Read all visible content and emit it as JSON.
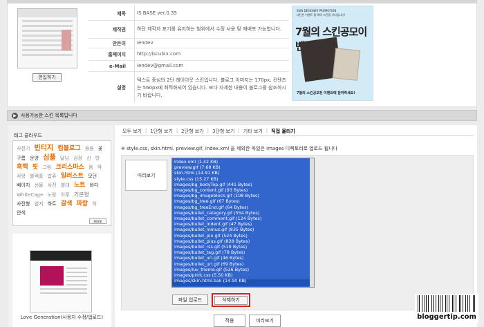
{
  "info": {
    "rows": [
      {
        "label": "제목",
        "value": "IS BASE ver.0.35"
      },
      {
        "label": "제작권",
        "value": "하단 제작자 표기를 유지하는 범위에서 수정 사용 및 재배포 가능합니다."
      },
      {
        "label": "만든이",
        "value": "iendev"
      },
      {
        "label": "홈페이지",
        "value": "http://iscubix.com"
      },
      {
        "label": "e-Mail",
        "value": "iendev@gmail.com"
      },
      {
        "label": "설명",
        "value": "텍스트 중심의 2단 레이아웃 스킨입니다. 블로그 이미지는 170px, 컨텐츠는 560px에 최적화되어 있습니다. 보다 자세한 내용이 블로그를 참조하시기 바랍니다."
      }
    ],
    "edit_button": "편집하기"
  },
  "banner": {
    "small_text": "SKIN DESIGNER PROMOTION",
    "small_text2": "대단한 이벤트 올 해의 스킨을 기다립니다!",
    "title": "7월의 스킨공모이벤트",
    "bottom_text": "7월의 스킨공모전 이벤트에 참여하세요!"
  },
  "section": {
    "title": "사용가능한 스킨 목록입니다"
  },
  "tag_cloud": {
    "title": "태그 클라우드",
    "tags": [
      {
        "text": "사진기",
        "style": "s"
      },
      {
        "text": "빈티지",
        "style": "ob"
      },
      {
        "text": "컴블로그",
        "style": "o"
      },
      {
        "text": "용용",
        "style": "s"
      },
      {
        "text": "꽃",
        "style": "d"
      },
      {
        "text": "구름",
        "style": "d"
      },
      {
        "text": "운양",
        "style": "d"
      },
      {
        "text": "심플",
        "style": "ob"
      },
      {
        "text": "달님",
        "style": "s"
      },
      {
        "text": "검정",
        "style": "s"
      },
      {
        "text": "신",
        "style": "s"
      },
      {
        "text": "방",
        "style": "s"
      },
      {
        "text": "흑백",
        "style": "o"
      },
      {
        "text": "핏",
        "style": "o"
      },
      {
        "text": "그림",
        "style": "s"
      },
      {
        "text": "크리스마스",
        "style": "o"
      },
      {
        "text": "음",
        "style": "s"
      },
      {
        "text": "악",
        "style": "s"
      },
      {
        "text": "사랑",
        "style": "s"
      },
      {
        "text": "블랙홀",
        "style": "s"
      },
      {
        "text": "밥쥬",
        "style": "s"
      },
      {
        "text": "일러스트",
        "style": "o"
      },
      {
        "text": "모던",
        "style": "d"
      },
      {
        "text": "베이지",
        "style": "d"
      },
      {
        "text": "선물",
        "style": "s"
      },
      {
        "text": "사진",
        "style": "s"
      },
      {
        "text": "블대",
        "style": "s"
      },
      {
        "text": "노트",
        "style": "o"
      },
      {
        "text": "바다",
        "style": "d"
      },
      {
        "text": "WhiteCage",
        "style": "s"
      },
      {
        "text": "노랑",
        "style": "s"
      },
      {
        "text": "이루",
        "style": "s"
      },
      {
        "text": "기본형",
        "style": "m"
      },
      {
        "text": "사진형",
        "style": "d"
      },
      {
        "text": "염지",
        "style": "s"
      },
      {
        "text": "하트",
        "style": "d"
      },
      {
        "text": "갈색",
        "style": "o"
      },
      {
        "text": "파랑",
        "style": "o"
      },
      {
        "text": "하",
        "style": "s"
      },
      {
        "text": "얀색",
        "style": "d"
      }
    ],
    "more": "MORE"
  },
  "skin_item": {
    "name": "Love Generation(사용자 수정/업로드)"
  },
  "tabs": {
    "items": [
      "모두 보기",
      "1단형 보기",
      "2단형 보기",
      "3단형 보기",
      "기타 보기",
      "직접 올리기"
    ],
    "active_index": 5
  },
  "upload": {
    "notice": "※ style.css, skin.html, preview.gif, index.xml 을 제외한 파일은 images 디렉토리로 업로드 됩니다",
    "preview_label": "미리보기",
    "files": [
      "index.xml (1.42 KB)",
      "preview.gif (7.68 KB)",
      "skin.html (14.91 KB)",
      "style.css (15.27 KB)",
      "images/bg_bodyTop.gif (441 Bytes)",
      "images/bg_content.gif (93 Bytes)",
      "images/bg_imageblock.gif (108 Bytes)",
      "images/bg_tree.gif (67 Bytes)",
      "images/bg_treeEnd.gif (64 Bytes)",
      "images/bullet_category.gif (554 Bytes)",
      "images/bullet_comment.gif (124 Bytes)",
      "images/bullet_indent.gif (47 Bytes)",
      "images/bullet_minus.gif (835 Bytes)",
      "images/bullet_pin.gif (524 Bytes)",
      "images/bullet_plus.gif (828 Bytes)",
      "images/bullet_rss.gif (518 Bytes)",
      "images/bullet_tag.gif (78 Bytes)",
      "images/bullet_url.gif (46 Bytes)",
      "images/bullet_url.gif (69 Bytes)",
      "images/luv_theme.gif (536 Bytes)",
      "images/print.css (5.50 KB)",
      "images/skin.html.bak (14.90 KB)"
    ],
    "upload_button": "파일 업로드",
    "delete_button": "삭제하기",
    "apply_button": "적용",
    "cancel_button": "미리보기"
  },
  "watermark": {
    "text": "bloggertip.com"
  }
}
